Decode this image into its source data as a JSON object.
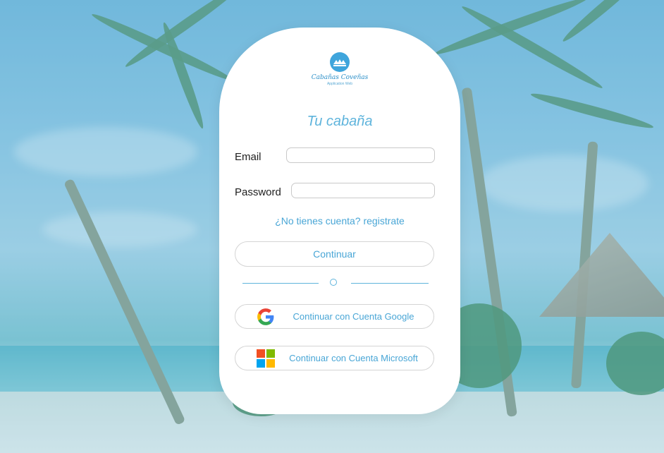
{
  "brand": {
    "name": "Cabañas Coveñas",
    "subtitle": "Application Web"
  },
  "login": {
    "title": "Tu cabaña",
    "email_label": "Email",
    "email_value": "",
    "password_label": "Password",
    "password_value": "",
    "register_link": "¿No tienes cuenta? registrate",
    "continue_label": "Continuar",
    "google_label": "Continuar con Cuenta Google",
    "microsoft_label": "Continuar con Cuenta Microsoft"
  },
  "colors": {
    "accent": "#49a6d6",
    "google_blue": "#4285F4",
    "google_red": "#EA4335",
    "google_yellow": "#FBBC05",
    "google_green": "#34A853",
    "ms_red": "#F25022",
    "ms_green": "#7FBA00",
    "ms_blue": "#00A4EF",
    "ms_yellow": "#FFB900"
  },
  "icons": [
    "google-icon",
    "microsoft-icon",
    "logo-icon"
  ]
}
